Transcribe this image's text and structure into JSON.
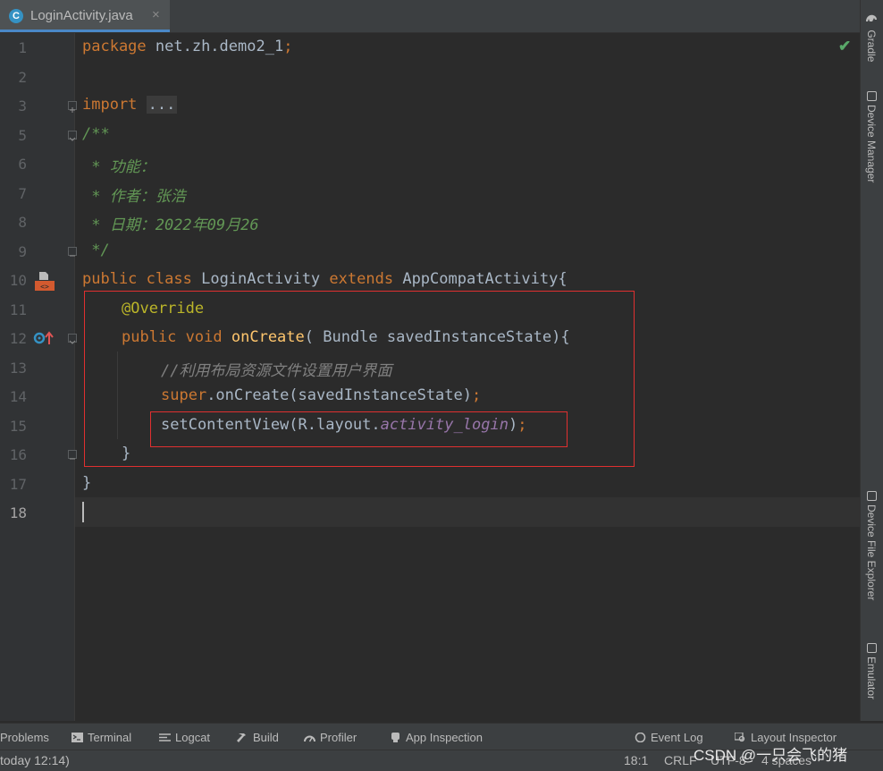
{
  "tab": {
    "icon": "java-class-icon",
    "icon_letter": "C",
    "name": "LoginActivity.java",
    "close": "×"
  },
  "editor": {
    "status_icon": "checkmark-icon",
    "current_line": "18",
    "lines": [
      {
        "n": "1"
      },
      {
        "n": "2"
      },
      {
        "n": "3"
      },
      {
        "n": "5"
      },
      {
        "n": "6"
      },
      {
        "n": "7"
      },
      {
        "n": "8"
      },
      {
        "n": "9"
      },
      {
        "n": "10"
      },
      {
        "n": "11"
      },
      {
        "n": "12"
      },
      {
        "n": "13"
      },
      {
        "n": "14"
      },
      {
        "n": "15"
      },
      {
        "n": "16"
      },
      {
        "n": "17"
      },
      {
        "n": "18"
      }
    ],
    "code": {
      "l1_kw": "package",
      "l1_rest": " net.zh.demo2_1",
      "l1_semi": ";",
      "l3_kw": "import",
      "l3_dots": "...",
      "l5": "/**",
      "l6": " * 功能：",
      "l7": " * 作者：张浩",
      "l8": " * 日期：2022年09月26",
      "l9": " */",
      "l10_kw1": "public",
      "l10_kw2": "class",
      "l10_name": "LoginActivity",
      "l10_kw3": "extends",
      "l10_super": "AppCompatActivity{",
      "l11": "@Override",
      "l12_kw1": "public",
      "l12_kw2": "void",
      "l12_fn": "onCreate",
      "l12_rest": "( Bundle savedInstanceState){",
      "l13": "//利用布局资源文件设置用户界面",
      "l14_kw": "super",
      "l14_rest": ".onCreate(savedInstanceState)",
      "l14_semi": ";",
      "l15_pre": "setContentView(R.layout.",
      "l15_it": "activity_login",
      "l15_post": ")",
      "l15_semi": ";",
      "l16": "}",
      "l17": "}"
    }
  },
  "right_tools": [
    "Gradle",
    "Device Manager",
    "Device File Explorer",
    "Emulator"
  ],
  "bottom_tools": {
    "problems": "Problems",
    "terminal": "Terminal",
    "logcat": "Logcat",
    "build": "Build",
    "profiler": "Profiler",
    "app_inspection": "App Inspection",
    "event_log": "Event Log",
    "layout_inspector": "Layout Inspector"
  },
  "status": {
    "message": "today 12:14)",
    "position": "18:1",
    "line_sep": "CRLF",
    "encoding": "UTF-8",
    "indent": "4 spaces"
  },
  "watermark": "CSDN @一只会飞的猪",
  "colors": {
    "keyword": "#cc7832",
    "annotation": "#bbb529",
    "function": "#ffc66d",
    "doc_comment": "#629755",
    "highlight_box": "#e03030"
  }
}
